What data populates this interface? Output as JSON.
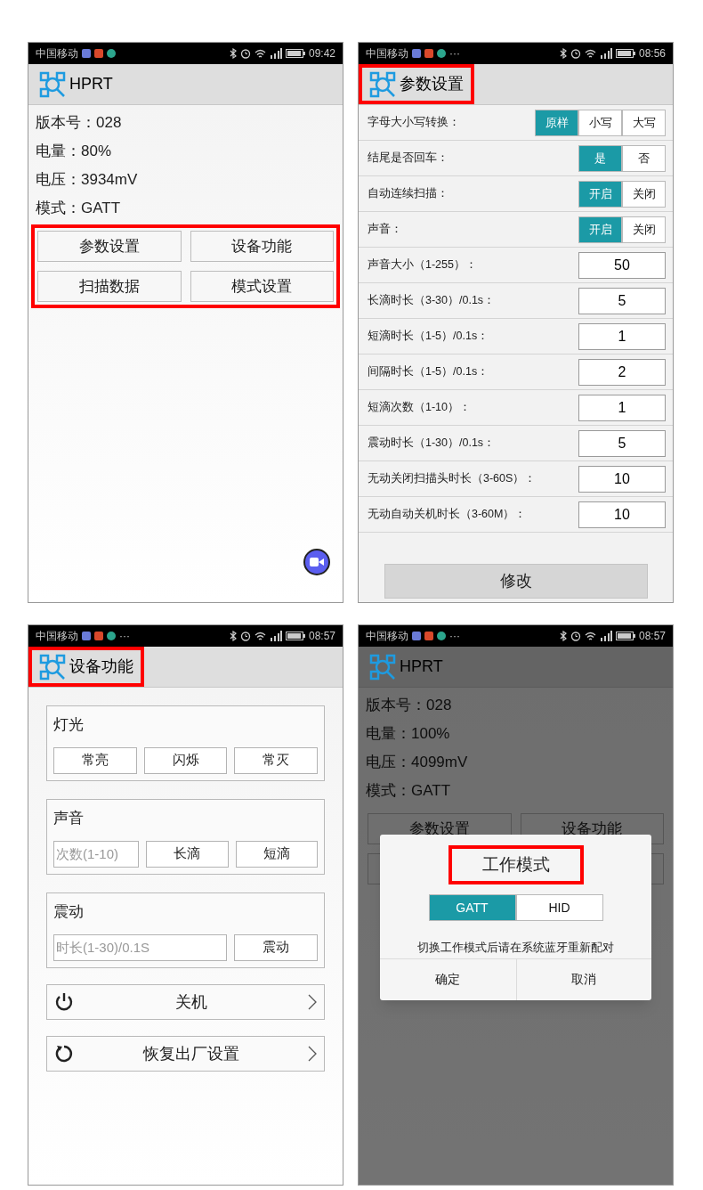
{
  "phones": [
    {
      "kind": "main",
      "status": {
        "carrier": "中国移动",
        "time": "09:42"
      },
      "title": "HPRT",
      "title_highlighted": false,
      "info": [
        "版本号：028",
        "电量：80%",
        "电压：3934mV",
        "模式：GATT"
      ],
      "buttons": [
        "参数设置",
        "设备功能",
        "扫描数据",
        "模式设置"
      ],
      "buttons_highlighted": true,
      "floating_button": true
    },
    {
      "kind": "settings",
      "status": {
        "carrier": "中国移动",
        "more": "···",
        "time": "08:56"
      },
      "title": "参数设置",
      "title_highlighted": true,
      "rows": [
        {
          "kind": "segmented",
          "label": "字母大小写转换：",
          "options": [
            {
              "label": "原样",
              "selected": true
            },
            {
              "label": "小写",
              "selected": false
            },
            {
              "label": "大写",
              "selected": false
            }
          ]
        },
        {
          "kind": "segmented",
          "label": "结尾是否回车：",
          "options": [
            {
              "label": "是",
              "selected": true
            },
            {
              "label": "否",
              "selected": false
            }
          ]
        },
        {
          "kind": "segmented",
          "label": "自动连续扫描：",
          "options": [
            {
              "label": "开启",
              "selected": true
            },
            {
              "label": "关闭",
              "selected": false
            }
          ]
        },
        {
          "kind": "segmented",
          "label": "声音：",
          "options": [
            {
              "label": "开启",
              "selected": true
            },
            {
              "label": "关闭",
              "selected": false
            }
          ]
        },
        {
          "kind": "input",
          "label": "声音大小（1-255）：",
          "value": "50"
        },
        {
          "kind": "input",
          "label": "长滴时长（3-30）/0.1s：",
          "value": "5"
        },
        {
          "kind": "input",
          "label": "短滴时长（1-5）/0.1s：",
          "value": "1"
        },
        {
          "kind": "input",
          "label": "间隔时长（1-5）/0.1s：",
          "value": "2"
        },
        {
          "kind": "input",
          "label": "短滴次数（1-10）：",
          "value": "1"
        },
        {
          "kind": "input",
          "label": "震动时长（1-30）/0.1s：",
          "value": "5"
        },
        {
          "kind": "input",
          "label": "无动关闭扫描头时长（3-60S）：",
          "value": "10"
        },
        {
          "kind": "input",
          "label": "无动自动关机时长（3-60M）：",
          "value": "10"
        }
      ],
      "submit": "修改"
    },
    {
      "kind": "device",
      "status": {
        "carrier": "中国移动",
        "more": "···",
        "time": "08:57"
      },
      "title": "设备功能",
      "title_highlighted": true,
      "groups": [
        {
          "kind": "buttons",
          "label": "灯光",
          "buttons": [
            "常亮",
            "闪烁",
            "常灭"
          ]
        },
        {
          "kind": "input",
          "label": "声音",
          "placeholder": "次数(1-10)",
          "buttons": [
            "长滴",
            "短滴"
          ]
        },
        {
          "kind": "input",
          "label": "震动",
          "placeholder": "时长(1-30)/0.1S",
          "buttons": [
            "震动"
          ]
        }
      ],
      "actions": [
        {
          "kind": "power",
          "label": "关机"
        },
        {
          "kind": "restore",
          "label": "恢复出厂设置"
        }
      ]
    },
    {
      "kind": "main",
      "status": {
        "carrier": "中国移动",
        "more": "···",
        "time": "08:57"
      },
      "title": "HPRT",
      "title_highlighted": false,
      "info": [
        "版本号：028",
        "电量：100%",
        "电压：4099mV",
        "模式：GATT"
      ],
      "buttons": [
        "参数设置",
        "设备功能"
      ],
      "buttons_highlighted": false,
      "dialog": {
        "title": "工作模式",
        "title_highlighted": true,
        "options": [
          {
            "label": "GATT",
            "selected": true
          },
          {
            "label": "HID",
            "selected": false
          }
        ],
        "message": "切换工作模式后请在系统蓝牙重新配对",
        "actions": [
          "确定",
          "取消"
        ]
      }
    }
  ]
}
